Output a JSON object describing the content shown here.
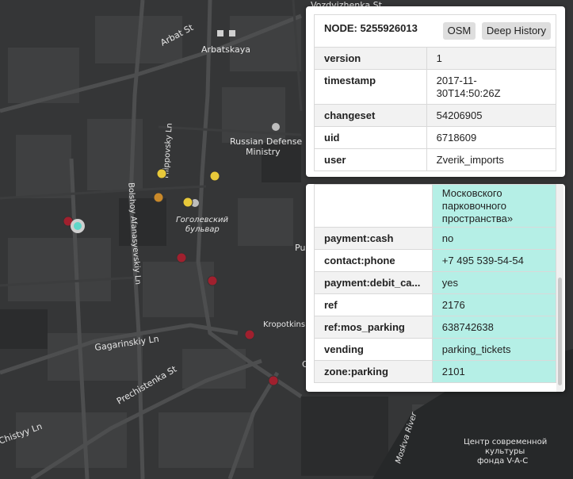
{
  "map_labels": {
    "street_top": "Vozdvizhenka St",
    "arbat_st": "Arbat St",
    "arbatskaya": "Arbatskaya",
    "russian_defense_1": "Russian Defense",
    "russian_defense_2": "Ministry",
    "filippovsky": "Filippovsky Ln",
    "gogolevsky_1": "Гоголевский",
    "gogolevsky_2": "бульвар",
    "bolshoy": "Bolshoy Afanasyevskiy Ln",
    "gagarinskiy": "Gagarinskiy Ln",
    "kropotkinskaya": "Kropotkinsk",
    "prechistenka": "Prechistenka St",
    "khrushchyovsky": "Chistyy Ln",
    "moskva_river": "Moskva River",
    "museum_1": "Центр современной",
    "museum_2": "культуры",
    "museum_3": "фонда V-A-C",
    "pus": "Pus",
    "o_label": "O"
  },
  "node": {
    "header": "NODE: 5255926013",
    "osm_button": "OSM",
    "history_button": "Deep History",
    "rows": [
      {
        "key": "version",
        "value": "1"
      },
      {
        "key": "timestamp",
        "value": "2017-11-30T14:50:26Z"
      },
      {
        "key": "changeset",
        "value": "54206905"
      },
      {
        "key": "uid",
        "value": "6718609"
      },
      {
        "key": "user",
        "value": "Zverik_imports"
      }
    ]
  },
  "tags": {
    "partial_value": "Московского парковочного пространства»",
    "rows": [
      {
        "key": "payment:cash",
        "value": "no"
      },
      {
        "key": "contact:phone",
        "value": "+7 495 539-54-54"
      },
      {
        "key": "payment:debit_ca...",
        "value": "yes"
      },
      {
        "key": "ref",
        "value": "2176"
      },
      {
        "key": "ref:mos_parking",
        "value": "638742638"
      },
      {
        "key": "vending",
        "value": "parking_tickets"
      },
      {
        "key": "zone:parking",
        "value": "2101"
      }
    ]
  },
  "colors": {
    "marker_red": "#a0202e",
    "marker_yellow": "#e8c93a",
    "marker_orange": "#c9892a",
    "marker_selected": "#5fd6c8",
    "tag_value_bg": "#b5efe6"
  }
}
